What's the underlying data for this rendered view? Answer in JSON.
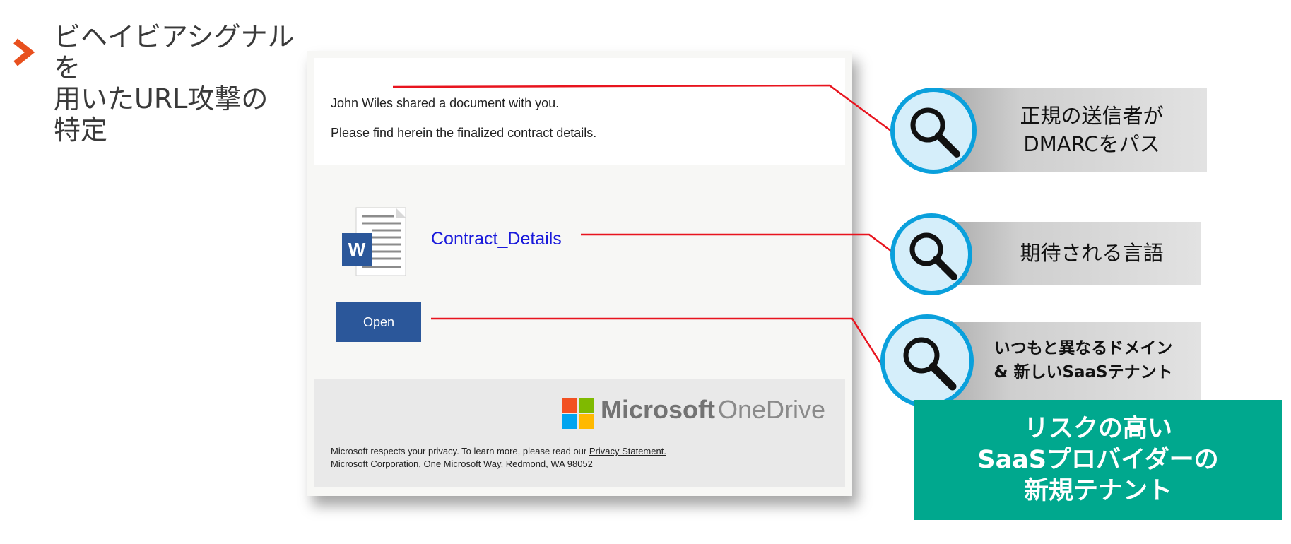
{
  "heading": {
    "line1": "ビヘイビアシグナルを",
    "line2": "用いたURL攻撃の",
    "line3": "特定"
  },
  "email": {
    "line1": "John Wiles shared a document with you.",
    "line2": "Please find herein the finalized contract details.",
    "document_link": "Contract_Details",
    "open_button": "Open",
    "brand_microsoft": "Microsoft",
    "brand_onedrive": "OneDrive",
    "footer_line1_prefix": "Microsoft respects your privacy. To learn more, please read our ",
    "footer_privacy_link": "Privacy Statement.",
    "footer_line2": "Microsoft Corporation, One Microsoft Way, Redmond, WA 98052"
  },
  "callouts": [
    {
      "line1": "正規の送信者が",
      "line2": "DMARCをパス",
      "icon": "magnifier-icon"
    },
    {
      "line1": "期待される言語",
      "icon": "magnifier-icon"
    },
    {
      "line1": "いつもと異なるドメイン",
      "line2": "& 新しいSaaSテナント",
      "icon": "magnifier-icon"
    }
  ],
  "risk": {
    "line1": "リスクの高い",
    "line2": "SaaSプロバイダーの",
    "line3": "新規テナント"
  },
  "colors": {
    "accent_orange": "#e8501e",
    "callout_line": "#e8141e",
    "magnifier_ring": "#0aa0dc",
    "risk_green": "#00a88e",
    "word_blue": "#2b579a"
  }
}
